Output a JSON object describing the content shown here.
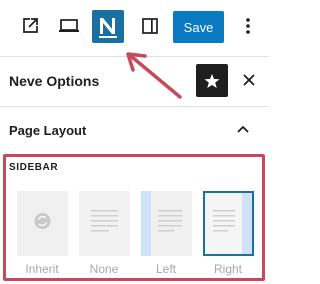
{
  "toolbar": {
    "external_link_icon": "external-link-icon",
    "laptop_icon": "laptop-icon",
    "neve_icon": "neve-logo-icon",
    "sidebar_icon": "sidebar-toggle-icon",
    "save_label": "Save",
    "more_icon": "vertical-ellipsis-icon"
  },
  "panel": {
    "title": "Neve Options",
    "star_icon": "star-icon",
    "close_icon": "close-icon"
  },
  "page_layout": {
    "title": "Page Layout",
    "collapse_icon": "chevron-up-icon",
    "sidebar": {
      "label": "SIDEBAR",
      "options": [
        {
          "label": "Inherit",
          "selected": false
        },
        {
          "label": "None",
          "selected": false
        },
        {
          "label": "Left",
          "selected": false
        },
        {
          "label": "Right",
          "selected": true
        }
      ]
    }
  },
  "colors": {
    "accent": "#0a7ac2",
    "neve_bg": "#1a6fa3",
    "highlight_border": "#c74a5c",
    "arrow": "#c74a5c",
    "sidebar_fill": "#cfe2f7"
  }
}
